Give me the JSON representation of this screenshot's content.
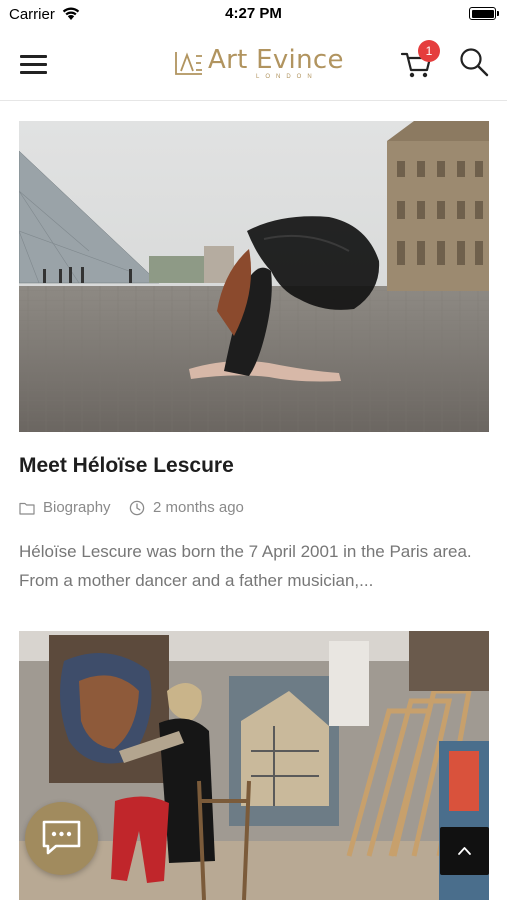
{
  "status_bar": {
    "carrier": "Carrier",
    "time": "4:27 PM"
  },
  "header": {
    "logo_text": "Art Evince",
    "logo_sub": "LONDON",
    "cart_count": "1",
    "brand_color": "#b1945f",
    "badge_color": "#e53d3d"
  },
  "posts": [
    {
      "title": "Meet Héloïse Lescure",
      "category": "Biography",
      "date": "2 months ago",
      "excerpt": "Héloïse Lescure was born the 7 April 2001 in the Paris area. From a mother dancer and a father musician,..."
    }
  ],
  "icons": [
    "menu-icon",
    "cart-icon",
    "search-icon",
    "folder-icon",
    "clock-icon",
    "chat-icon",
    "chevron-up-icon",
    "wifi-icon",
    "battery-icon"
  ],
  "colors": {
    "chat_button": "#a18b5e",
    "top_button": "#111111"
  }
}
